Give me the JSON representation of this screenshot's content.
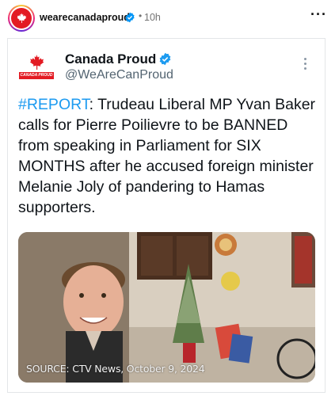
{
  "post": {
    "username": "wearecanadaproud",
    "separator": "•",
    "time": "10h",
    "more": "···"
  },
  "tweet": {
    "display_name": "Canada Proud",
    "handle": "@WeAreCanProud",
    "logo_text": "CANADA PROUD",
    "hashtag": "#REPORT",
    "body": ": Trudeau Liberal MP Yvan Baker calls for Pierre Poilievre to be BANNED from speaking in Parliament for SIX MONTHS after he accused foreign minister Melanie Joly of pandering to Hamas supporters.",
    "image_caption": "SOURCE: CTV News, October 9, 2024"
  },
  "colors": {
    "brand_red": "#e31b23",
    "verified_blue": "#1d9bf0",
    "hashtag_blue": "#1d9bf0",
    "handle_gray": "#536471"
  },
  "icons": {
    "avatar": "maple-leaf-icon",
    "verified": "verified-badge-icon",
    "more": "more-options-icon"
  }
}
